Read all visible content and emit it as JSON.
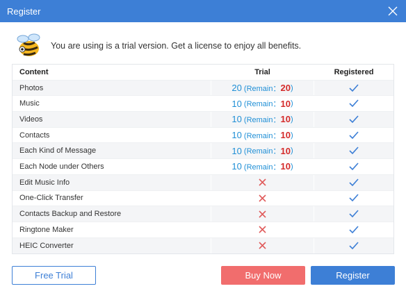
{
  "window": {
    "title": "Register"
  },
  "intro": {
    "message": "You are using is a trial version. Get a license to enjoy all benefits."
  },
  "table": {
    "headers": {
      "content": "Content",
      "trial": "Trial",
      "registered": "Registered"
    },
    "remain_label": "(Remain：",
    "remain_close": ")",
    "rows": [
      {
        "label": "Photos",
        "trial": "20",
        "remain": "20",
        "registered": "check"
      },
      {
        "label": "Music",
        "trial": "10",
        "remain": "10",
        "registered": "check"
      },
      {
        "label": "Videos",
        "trial": "10",
        "remain": "10",
        "registered": "check"
      },
      {
        "label": "Contacts",
        "trial": "10",
        "remain": "10",
        "registered": "check"
      },
      {
        "label": "Each Kind of Message",
        "trial": "10",
        "remain": "10",
        "registered": "check"
      },
      {
        "label": "Each Node under  Others",
        "trial": "10",
        "remain": "10",
        "registered": "check"
      },
      {
        "label": "Edit Music Info",
        "trial": "cross",
        "registered": "check"
      },
      {
        "label": "One-Click Transfer",
        "trial": "cross",
        "registered": "check"
      },
      {
        "label": "Contacts Backup and Restore",
        "trial": "cross",
        "registered": "check"
      },
      {
        "label": "Ringtone Maker",
        "trial": "cross",
        "registered": "check"
      },
      {
        "label": "HEIC Converter",
        "trial": "cross",
        "registered": "check"
      }
    ]
  },
  "buttons": {
    "free_trial": "Free Trial",
    "buy_now": "Buy Now",
    "register": "Register"
  },
  "colors": {
    "accent": "#3d7fd6",
    "buy": "#f16d6d",
    "trial_number": "#1f8fd6",
    "remain_number": "#d42a2a",
    "check": "#3d7fd6",
    "cross": "#e05a5a"
  }
}
